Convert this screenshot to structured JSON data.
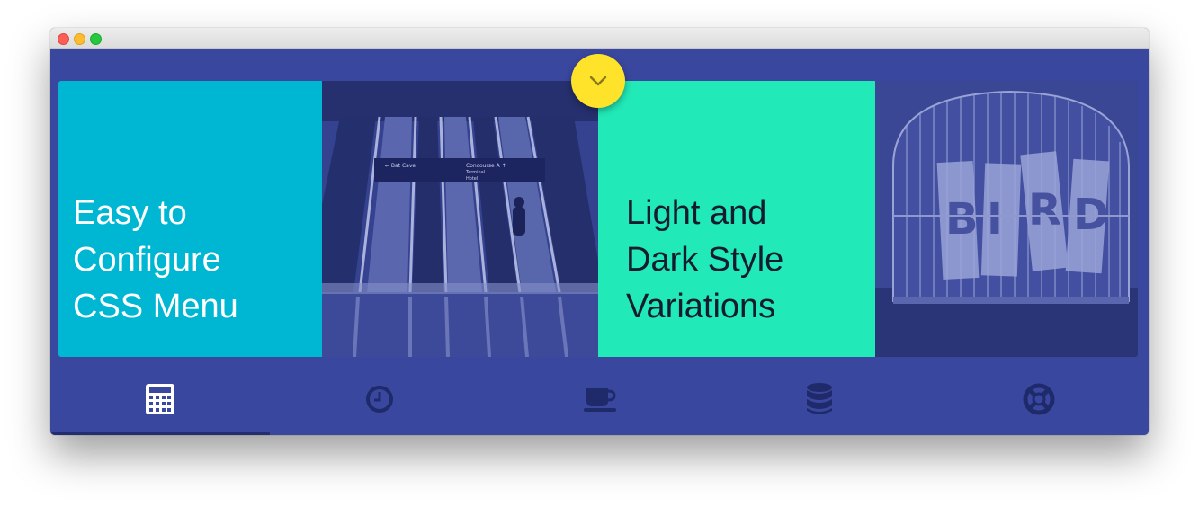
{
  "window": {
    "controls": [
      "close",
      "minimize",
      "zoom"
    ]
  },
  "toggle": {
    "icon": "chevron-down-icon"
  },
  "cards": [
    {
      "title": "Easy to\nConfigure\nCSS Menu",
      "color": "#00b7d3"
    },
    {
      "image": "escalators-photo"
    },
    {
      "title": "Light and\nDark Style\nVariations",
      "color": "#21e9b7"
    },
    {
      "image": "birdcage-photo"
    }
  ],
  "tabs": [
    {
      "icon": "calculator-icon",
      "active": true
    },
    {
      "icon": "clock-icon",
      "active": false
    },
    {
      "icon": "coffee-cup-icon",
      "active": false
    },
    {
      "icon": "database-icon",
      "active": false
    },
    {
      "icon": "life-ring-icon",
      "active": false
    }
  ],
  "colors": {
    "background": "#3a479f",
    "accent_yellow": "#ffe22a",
    "icon_inactive": "#1f2a6b",
    "icon_active": "#ffffff"
  }
}
